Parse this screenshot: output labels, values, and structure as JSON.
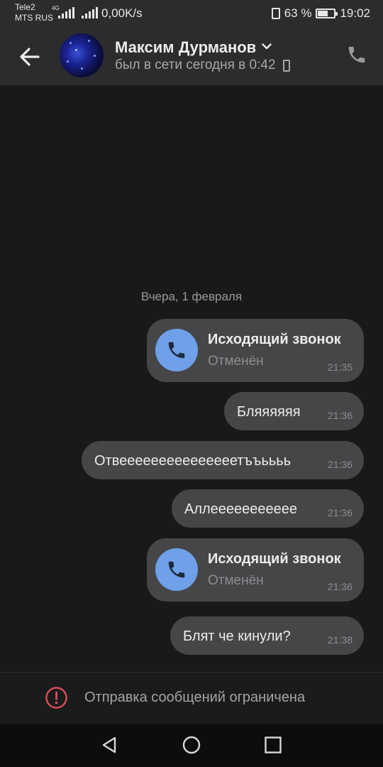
{
  "statusbar": {
    "carrier1": "Tele2",
    "carrier2": "MTS RUS",
    "network_type": "4G",
    "data_speed": "0,00K/s",
    "battery_percent": "63 %",
    "battery_level": 0.63,
    "time": "19:02"
  },
  "header": {
    "contact_name": "Максим Дурманов",
    "last_seen": "был в сети сегодня в 0:42",
    "back_icon": "arrow-left-icon",
    "call_icon": "phone-icon"
  },
  "chat": {
    "date_separator": "Вчера, 1 февраля",
    "messages": [
      {
        "type": "call",
        "title": "Исходящий звонок",
        "subtitle": "Отменён",
        "time": "21:35"
      },
      {
        "type": "text",
        "text": "Бляяяяяя",
        "time": "21:36"
      },
      {
        "type": "text",
        "text": "Отвееееееееееееееетъъьььь",
        "time": "21:36"
      },
      {
        "type": "text",
        "text": "Аллеееееееееее",
        "time": "21:36"
      },
      {
        "type": "call",
        "title": "Исходящий звонок",
        "subtitle": "Отменён",
        "time": "21:36"
      },
      {
        "type": "text",
        "text": "Блят че кинули?",
        "time": "21:38"
      }
    ]
  },
  "footer": {
    "restriction_text": "Отправка сообщений ограничена",
    "warning_icon": "exclamation-circle-icon",
    "warning_color": "#e0505a"
  },
  "colors": {
    "call_icon_bg": "#6fa0e8",
    "bubble_bg": "#464649",
    "header_bg": "#2c2c2e"
  }
}
